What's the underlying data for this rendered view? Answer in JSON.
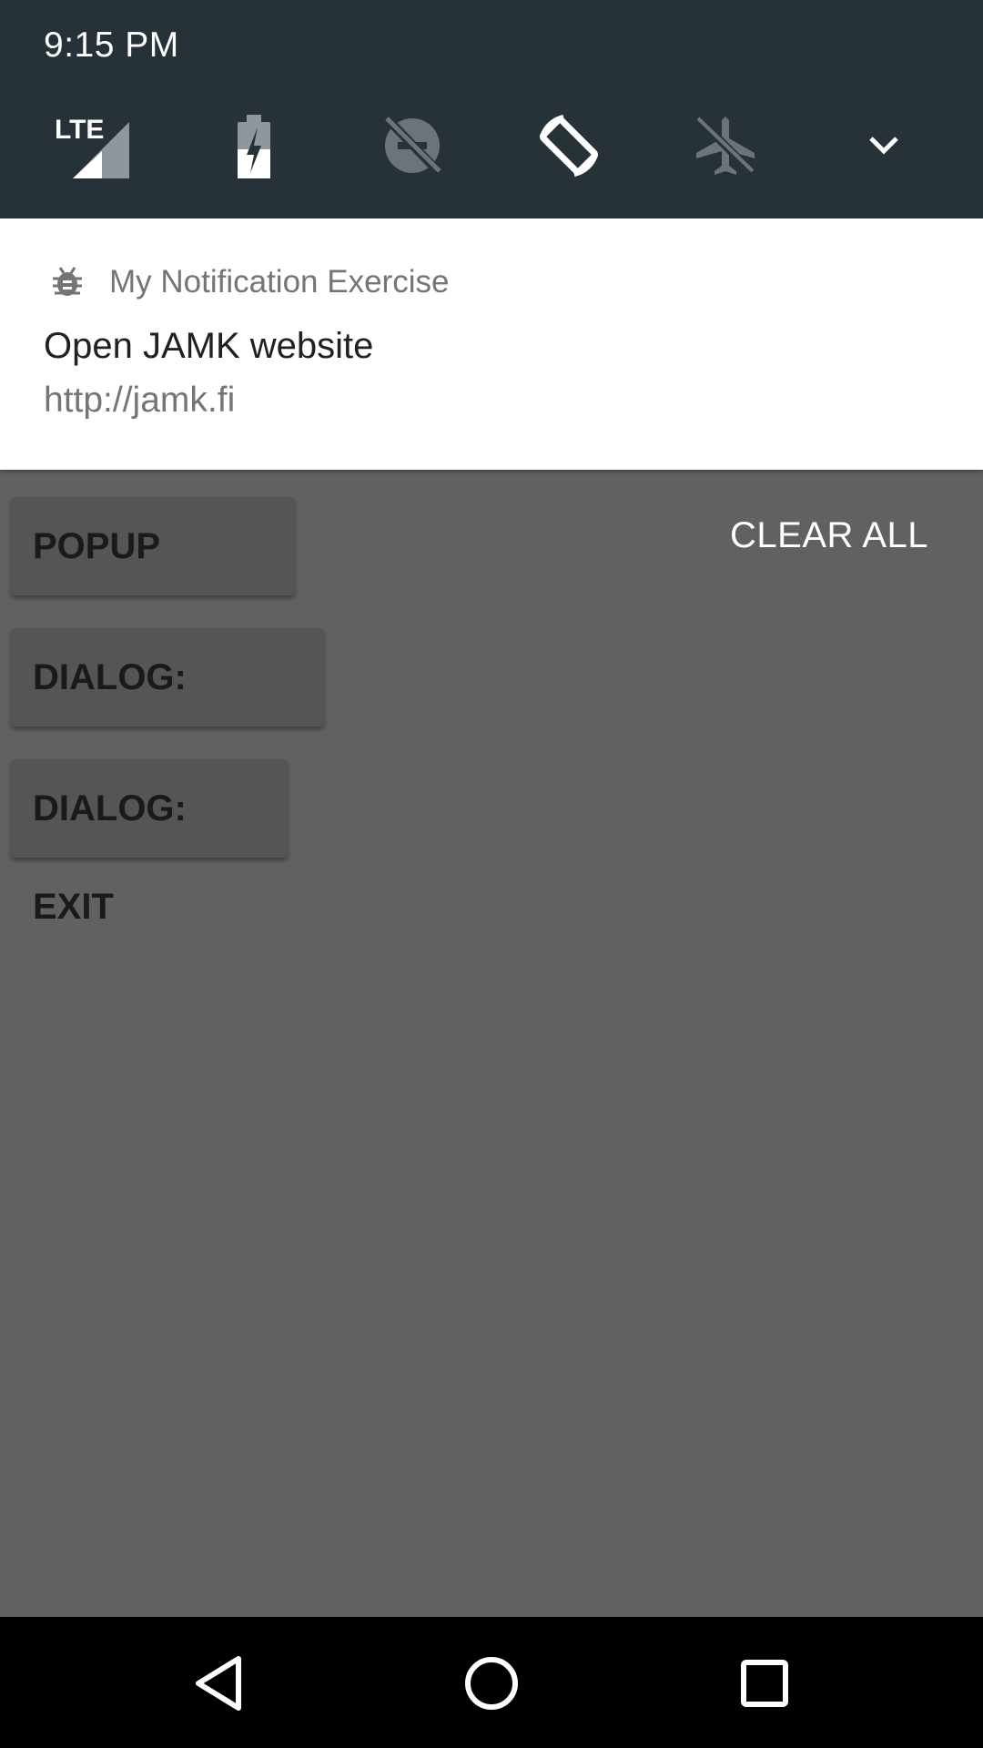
{
  "status_bar": {
    "time": "9:15 PM"
  },
  "quick_settings": {
    "tiles": [
      {
        "icon": "lte-signal-icon",
        "label": "LTE"
      },
      {
        "icon": "battery-saver-icon"
      },
      {
        "icon": "do-not-disturb-off-icon"
      },
      {
        "icon": "auto-rotate-icon"
      },
      {
        "icon": "airplane-mode-off-icon"
      },
      {
        "icon": "expand-chevron-icon"
      }
    ]
  },
  "notification": {
    "app_name": "My Notification Exercise",
    "app_icon": "bug-icon",
    "title": "Open JAMK website",
    "text": "http://jamk.fi"
  },
  "app": {
    "buttons": {
      "popup_menu": "POPUP MENU",
      "dialog_hello": "DIALOG: HELLO",
      "dialog_exit": "DIALOG: EXIT"
    }
  },
  "shade": {
    "clear_all": "CLEAR ALL"
  },
  "colors": {
    "shade_header": "#263238",
    "scrim": "#616161",
    "notification_bg": "#ffffff",
    "navbar": "#000000"
  }
}
